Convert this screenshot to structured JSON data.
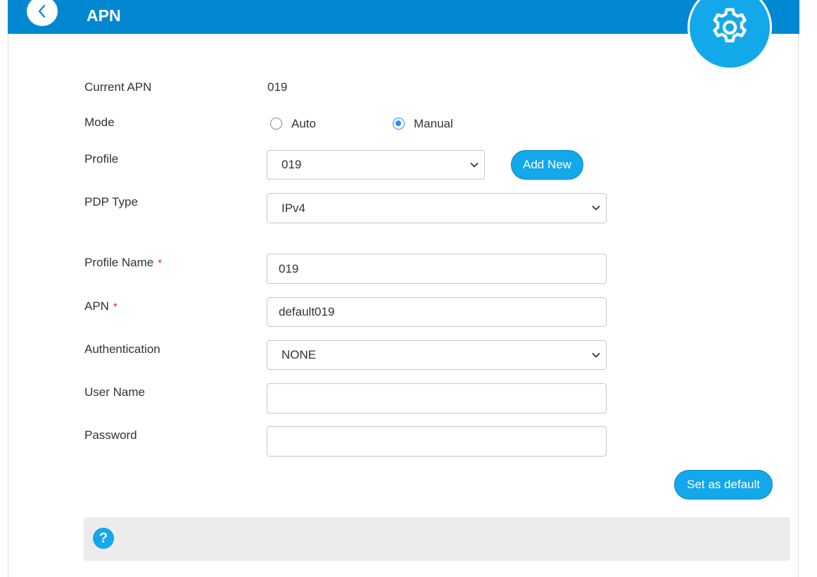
{
  "header": {
    "title": "APN"
  },
  "form": {
    "current_apn": {
      "label": "Current APN",
      "value": "019"
    },
    "mode": {
      "label": "Mode",
      "options": [
        {
          "label": "Auto",
          "checked": false
        },
        {
          "label": "Manual",
          "checked": true
        }
      ]
    },
    "profile": {
      "label": "Profile",
      "selected": "019",
      "add_new": "Add New"
    },
    "pdp_type": {
      "label": "PDP Type",
      "selected": "IPv4"
    },
    "profile_name": {
      "label": "Profile Name",
      "required_mark": "*",
      "value": "019"
    },
    "apn": {
      "label": "APN",
      "required_mark": "*",
      "value": "default019"
    },
    "authentication": {
      "label": "Authentication",
      "selected": "NONE"
    },
    "user_name": {
      "label": "User Name",
      "value": ""
    },
    "password": {
      "label": "Password",
      "value": ""
    }
  },
  "actions": {
    "set_default": "Set as default"
  },
  "help": {
    "icon_glyph": "?"
  },
  "colors": {
    "header": "#0288d1",
    "accent": "#13a8ea",
    "radio": "#1e90ff",
    "required": "#e0243a"
  }
}
